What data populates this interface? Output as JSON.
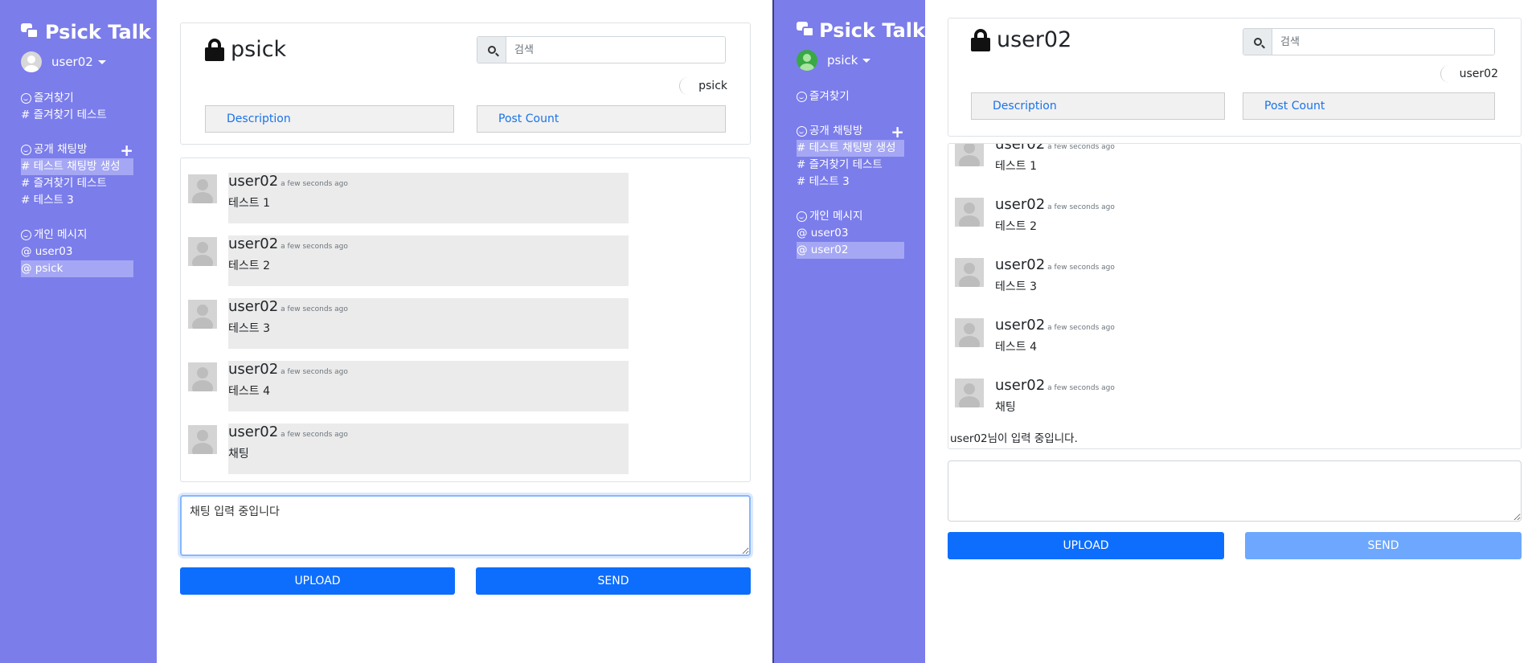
{
  "left": {
    "sidebar": {
      "brand": "Psick Talk",
      "user": "user02",
      "favorites": {
        "title": "즐겨찾기",
        "items": [
          "# 즐겨찾기 테스트"
        ]
      },
      "public": {
        "title": "공개 채팅방",
        "items": [
          "# 테스트 채팅방 생성",
          "# 즐겨찾기 테스트",
          "# 테스트 3"
        ],
        "active_index": 0
      },
      "direct": {
        "title": "개인 메시지",
        "items": [
          "@ user03",
          "@ psick"
        ],
        "active_index": 1
      }
    },
    "header": {
      "room": "psick",
      "search_placeholder": "검색",
      "member": "psick",
      "description_label": "Description",
      "post_count_label": "Post Count"
    },
    "messages": [
      {
        "author": "user02",
        "time": "a few seconds ago",
        "text": "테스트 1"
      },
      {
        "author": "user02",
        "time": "a few seconds ago",
        "text": "테스트 2"
      },
      {
        "author": "user02",
        "time": "a few seconds ago",
        "text": "테스트 3"
      },
      {
        "author": "user02",
        "time": "a few seconds ago",
        "text": "테스트 4"
      },
      {
        "author": "user02",
        "time": "a few seconds ago",
        "text": "채팅"
      }
    ],
    "composer_value": "채팅 입력 중입니다",
    "upload_label": "UPLOAD",
    "send_label": "SEND"
  },
  "right": {
    "sidebar": {
      "brand": "Psick Talk",
      "user": "psick",
      "favorites": {
        "title": "즐겨찾기",
        "items": []
      },
      "public": {
        "title": "공개 채팅방",
        "items": [
          "# 테스트 채팅방 생성",
          "# 즐겨찾기 테스트",
          "# 테스트 3"
        ],
        "active_index": 0
      },
      "direct": {
        "title": "개인 메시지",
        "items": [
          "@ user03",
          "@ user02"
        ],
        "active_index": 1
      }
    },
    "header": {
      "room": "user02",
      "search_placeholder": "검색",
      "member": "user02",
      "description_label": "Description",
      "post_count_label": "Post Count"
    },
    "messages": [
      {
        "author": "user02",
        "time": "a few seconds ago",
        "text": "테스트 1"
      },
      {
        "author": "user02",
        "time": "a few seconds ago",
        "text": "테스트 2"
      },
      {
        "author": "user02",
        "time": "a few seconds ago",
        "text": "테스트 3"
      },
      {
        "author": "user02",
        "time": "a few seconds ago",
        "text": "테스트 4"
      },
      {
        "author": "user02",
        "time": "a few seconds ago",
        "text": "채팅"
      }
    ],
    "typing_indicator": "user02님이 입력 중입니다.",
    "composer_value": "",
    "upload_label": "UPLOAD",
    "send_label": "SEND"
  },
  "colors": {
    "sidebar": "#7b7deb",
    "sidebar_active": "#a5a7f4",
    "primary": "#0d6efd",
    "primary_disabled": "#6ea8fe",
    "link": "#1a73e8"
  }
}
